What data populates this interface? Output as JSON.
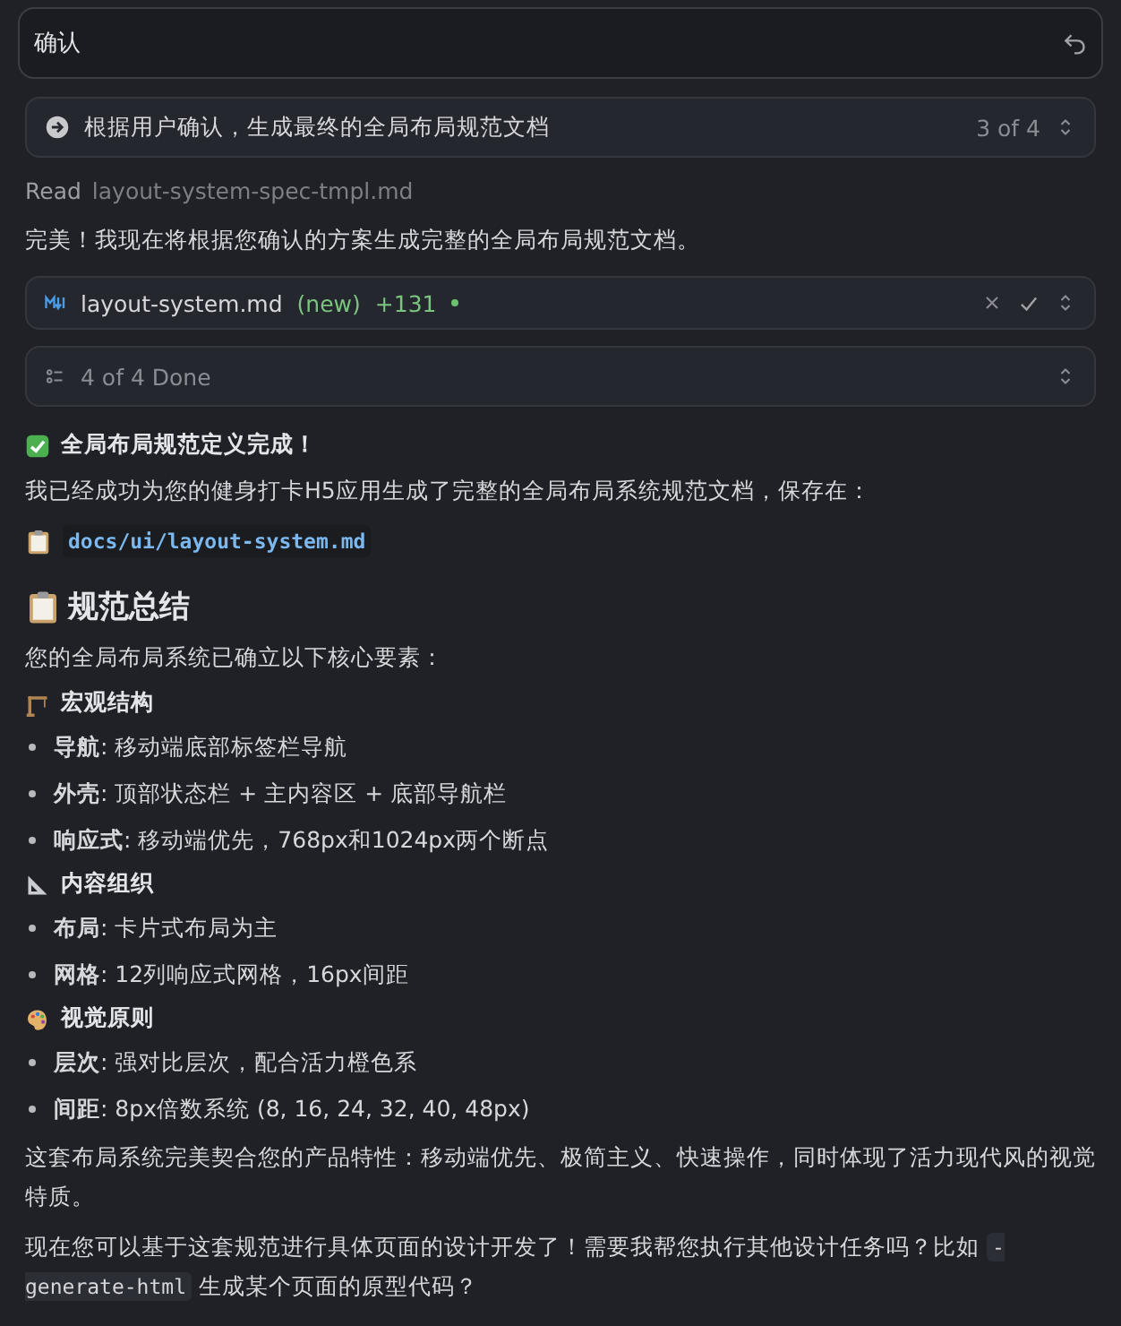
{
  "input": {
    "value": "确认"
  },
  "plan_step": {
    "text": "根据用户确认，生成最终的全局布局规范文档",
    "counter": "3 of 4"
  },
  "read_line": {
    "verb": "Read",
    "file": "layout-system-spec-tmpl.md"
  },
  "intro": "完美！我现在将根据您确认的方案生成完整的全局布局规范文档。",
  "file_change": {
    "filename": "layout-system.md",
    "status": "(new)",
    "additions": "+131"
  },
  "todo": {
    "text": "4 of 4 Done"
  },
  "blocks": [
    {
      "kind": "done",
      "text": "全局布局规范定义完成！"
    },
    {
      "kind": "paragraph",
      "text": "我已经成功为您的健身打卡H5应用生成了完整的全局布局系统规范文档，保存在："
    },
    {
      "kind": "path",
      "text": "docs/ui/layout-system.md"
    },
    {
      "kind": "title",
      "text": "规范总结"
    },
    {
      "kind": "paragraph",
      "text": "您的全局布局系统已确立以下核心要素："
    },
    {
      "kind": "subheading",
      "text": "宏观结构"
    },
    {
      "kind": "bullet",
      "text": "**导航**: 移动端底部标签栏导航"
    },
    {
      "kind": "bullet",
      "text": "**外壳**: 顶部状态栏 + 主内容区 + 底部导航栏"
    },
    {
      "kind": "bullet",
      "text": "**响应式**: 移动端优先，768px和1024px两个断点"
    },
    {
      "kind": "subheading",
      "text": "内容组织"
    },
    {
      "kind": "bullet",
      "text": "**布局**: 卡片式布局为主"
    },
    {
      "kind": "bullet",
      "text": "**网格**: 12列响应式网格，16px间距"
    },
    {
      "kind": "subheading",
      "text": "视觉原则"
    },
    {
      "kind": "bullet",
      "text": "**层次**: 强对比层次，配合活力橙色系"
    },
    {
      "kind": "bullet",
      "text": "**间距**: 8px倍数系统 (8, 16, 24, 32, 40, 48px)"
    },
    {
      "kind": "paragraph",
      "text": "这套布局系统完美契合您的产品特性：移动端优先、极简主义、快速操作，同时体现了活力现代风的视觉特质。"
    },
    {
      "kind": "code_paragraph",
      "before": "现在您可以基于这套规范进行具体页面的设计开发了！需要我帮您执行其他设计任务吗？比如",
      "code": "-generate-html",
      "after": "生成某个页面的原型代码？"
    }
  ]
}
